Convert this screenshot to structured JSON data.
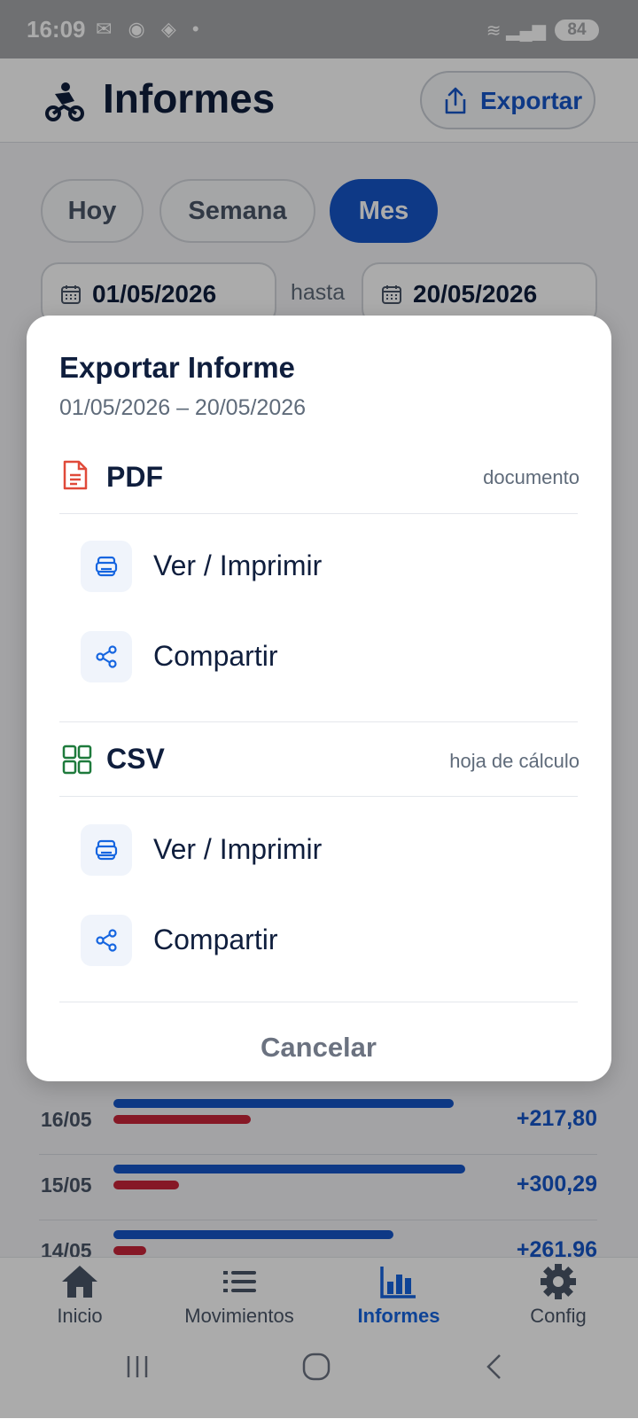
{
  "status": {
    "time": "16:09",
    "battery": "84"
  },
  "header": {
    "title": "Informes",
    "export_label": "Exportar"
  },
  "period": {
    "tabs": [
      "Hoy",
      "Semana",
      "Mes"
    ],
    "active": "Mes"
  },
  "range": {
    "from": "01/05/2026",
    "sep": "hasta",
    "to": "20/05/2026"
  },
  "rows": [
    {
      "date": "16/05",
      "value": "+217,80",
      "income": 0.62,
      "expense": 0.25
    },
    {
      "date": "15/05",
      "value": "+300,29",
      "income": 0.64,
      "expense": 0.12
    },
    {
      "date": "14/05",
      "value": "+261,96",
      "income": 0.51,
      "expense": 0.06
    }
  ],
  "nav": {
    "items": [
      "Inicio",
      "Movimientos",
      "Informes",
      "Config"
    ],
    "active": "Informes"
  },
  "sheet": {
    "title": "Exportar Informe",
    "subtitle": "01/05/2026 – 20/05/2026",
    "pdf": {
      "label": "PDF",
      "hint": "documento",
      "view": "Ver / Imprimir",
      "share": "Compartir"
    },
    "csv": {
      "label": "CSV",
      "hint": "hoja de cálculo",
      "view": "Ver / Imprimir",
      "share": "Compartir"
    },
    "cancel": "Cancelar"
  },
  "colors": {
    "primary": "#1556c8",
    "expense": "#c8243a",
    "pdf": "#e04a3a",
    "csv": "#1e7a3c"
  }
}
